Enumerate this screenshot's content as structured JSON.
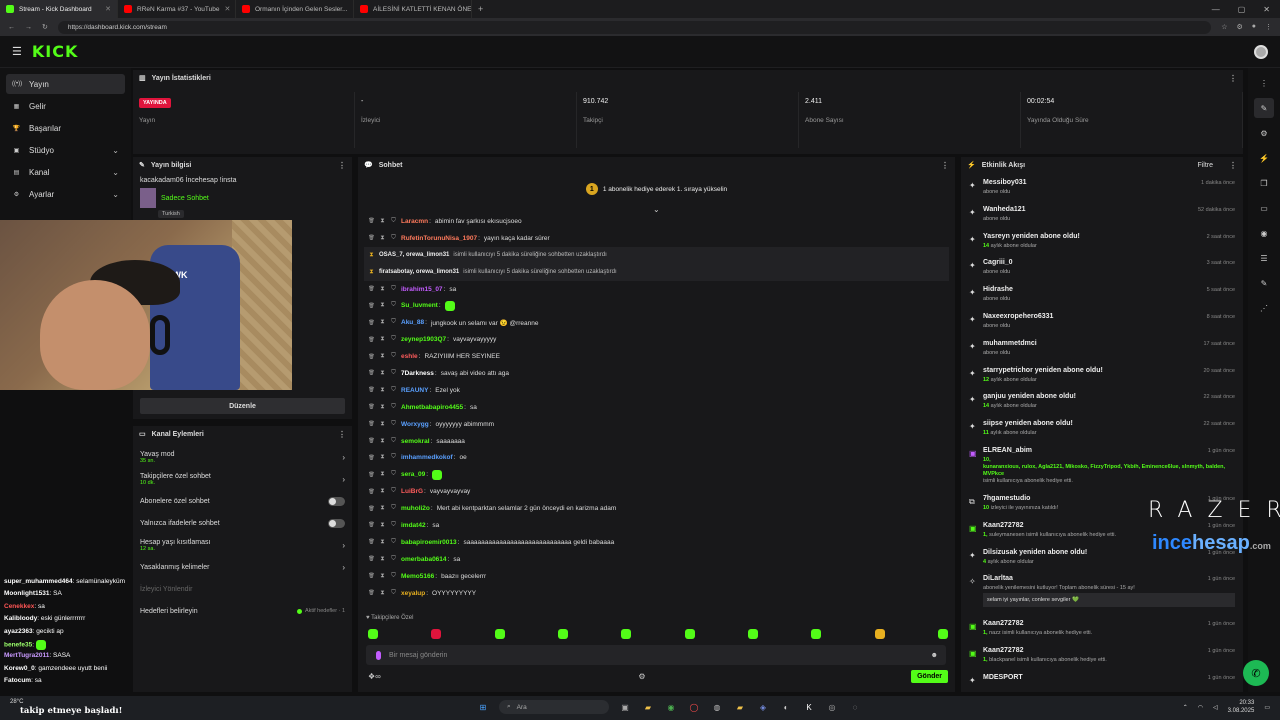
{
  "browser": {
    "tabs": [
      {
        "label": "Stream - Kick Dashboard",
        "color": "#53fc18"
      },
      {
        "label": "RReN Karma #37 - YouTube",
        "color": "#ff0000"
      },
      {
        "label": "Ormanın İçinden Gelen Sesler...",
        "color": "#ff0000"
      },
      {
        "label": "AİLESİNİ KATLETTİ KENAN ÖNEL...",
        "color": "#ff0000"
      }
    ],
    "url": "https://dashboard.kick.com/stream"
  },
  "brand": {
    "logo": "KICK"
  },
  "nav": [
    {
      "label": "Yayın",
      "icon": "broadcast-icon",
      "glyph": "((•))",
      "active": true
    },
    {
      "label": "Gelir",
      "icon": "revenue-icon",
      "glyph": "▦"
    },
    {
      "label": "Başarılar",
      "icon": "trophy-icon",
      "glyph": "🏆"
    },
    {
      "label": "Stüdyo",
      "icon": "studio-icon",
      "glyph": "▣",
      "chevron": true
    },
    {
      "label": "Kanal",
      "icon": "channel-icon",
      "glyph": "▤",
      "chevron": true
    },
    {
      "label": "Ayarlar",
      "icon": "settings-icon",
      "glyph": "⚙",
      "chevron": true
    }
  ],
  "stats": {
    "title": "Yayın İstatistikleri",
    "items": [
      {
        "value": "YAYINDA",
        "label": "Yayın"
      },
      {
        "value": "-",
        "label": "İzleyici"
      },
      {
        "value": "910.742",
        "label": "Takipçi"
      },
      {
        "value": "2.411",
        "label": "Abone Sayısı"
      },
      {
        "value": "00:02:54",
        "label": "Yayında Olduğu Süre"
      }
    ]
  },
  "yayin_info": {
    "title": "Yayın bilgisi",
    "stream_title": "kacakadam06 İncehesap !insta",
    "mode": "Sadece Sohbet",
    "language": "Turkish",
    "edit_label": "Düzenle",
    "cam_label": "HAWK"
  },
  "kanal": {
    "title": "Kanal Eylemleri",
    "items": [
      {
        "label": "Yavaş mod",
        "sub": "35 sn.",
        "control": "arrow"
      },
      {
        "label": "Takipçilere özel sohbet",
        "sub": "10 dk.",
        "control": "arrow"
      },
      {
        "label": "Abonelere özel sohbet",
        "sub": "",
        "control": "toggle"
      },
      {
        "label": "Yalnızca ifadelerle sohbet",
        "sub": "",
        "control": "toggle"
      },
      {
        "label": "Hesap yaşı kısıtlaması",
        "sub": "12 sa.",
        "control": "arrow"
      },
      {
        "label": "Yasaklanmış kelimeler",
        "sub": "",
        "control": "arrow"
      }
    ],
    "muted_label": "İzleyici Yönlendir",
    "goals_label": "Hedefleri belirleyin",
    "goals_status": "Aktif hedefler · 1"
  },
  "overlay_chat": [
    {
      "user": "super_muhammed464",
      "text": "selamünaleyküm",
      "color": "#ffffff"
    },
    {
      "user": "Moonlight1531",
      "text": "SA",
      "color": "#ffffff"
    },
    {
      "user": "Cenekkex",
      "text": "sa",
      "color": "#ff5555"
    },
    {
      "user": "Kalibloody",
      "text": "eski günlerrrrrrr",
      "color": "#ffffff"
    },
    {
      "user": "ayaz2363",
      "text": "gecikti ap",
      "color": "#ffffff"
    },
    {
      "user": "benefe35",
      "text": "",
      "color": "#9bff6b",
      "emote": true
    },
    {
      "user": "MertTugra2011",
      "text": "SASA",
      "color": "#c99aff"
    },
    {
      "user": "Korew0_0",
      "text": "gamzendeee uyutt benii",
      "color": "#ffffff"
    },
    {
      "user": "Fatocum",
      "text": "sa",
      "color": "#ffffff"
    }
  ],
  "chat": {
    "title": "Sohbet",
    "pinned": "1 abonelik hediye ederek 1. sıraya yükselin",
    "pin_num": "1",
    "messages": [
      {
        "user": "Laracmn",
        "text": "abimin fav şarkısı ekısucjsoeo",
        "color": "#ff7a5c"
      },
      {
        "user": "RufetinTorunuNisa_1907",
        "text": "yayın kaça kadar sürer",
        "color": "#ff7a5c"
      },
      {
        "sys": true,
        "user": "OSAS_7, orewa_limon31",
        "text": "isimli kullanıcıyı 5 dakika süreliğine sohbetten uzaklaştırdı"
      },
      {
        "sys": true,
        "user": "firatsabotay, orewa_limon31",
        "text": "isimli kullanıcıyı 5 dakika süreliğine sohbetten uzaklaştırdı"
      },
      {
        "user": "ibrahim15_07",
        "text": "sa",
        "color": "#c35cff"
      },
      {
        "user": "Su_luvment",
        "text": "",
        "color": "#53fc18",
        "emote": true
      },
      {
        "user": "Aku_88",
        "text": "jungkook un selamı var 😉 @rreanne",
        "color": "#5aa0ff"
      },
      {
        "user": "zeynep1903Q7",
        "text": "vayvayvayyyyy",
        "color": "#53fc18"
      },
      {
        "user": "eshle",
        "text": "RAZIYIIIM HER SEYINEE",
        "color": "#ff5c5c"
      },
      {
        "user": "7Darkness",
        "text": "savaş abi video attı aga",
        "color": "#ffffff"
      },
      {
        "user": "REAUNY",
        "text": "Ezel yok",
        "color": "#5aa0ff"
      },
      {
        "user": "Ahmetbabapiro4455",
        "text": "sa",
        "color": "#53fc18"
      },
      {
        "user": "Worxygg",
        "text": "oyyyyyyy abimmmm",
        "color": "#5aa0ff"
      },
      {
        "user": "semokral",
        "text": "saaaaaaa",
        "color": "#53fc18"
      },
      {
        "user": "imhammedkokof",
        "text": "oe",
        "color": "#5aa0ff"
      },
      {
        "user": "sera_09",
        "text": "",
        "color": "#53fc18",
        "emote": true
      },
      {
        "user": "LuiBrG",
        "text": "vayvayvayvay",
        "color": "#ff5c5c"
      },
      {
        "user": "muholi2o",
        "text": "Mert abi kentparktan selamlar 2 gün önceydi en karizma adam",
        "color": "#53fc18"
      },
      {
        "user": "imdat42",
        "text": "sa",
        "color": "#53fc18"
      },
      {
        "user": "babapiroemir0013",
        "text": "saaaaaaaaaaaaaaaaaaaaaaaaaaaaa geldi babaaaa",
        "color": "#53fc18"
      },
      {
        "user": "omerbaba0614",
        "text": "sa",
        "color": "#53fc18"
      },
      {
        "user": "Memo5166",
        "text": "baazıı gecelerrr",
        "color": "#53fc18"
      },
      {
        "user": "xeyalup",
        "text": "OYYYYYYYYY",
        "color": "#e8b020"
      }
    ],
    "followers_only": "Takipçilere Özel",
    "input_placeholder": "Bir mesaj gönderin",
    "send_label": "Gönder"
  },
  "events": {
    "title": "Etkinlik Akışı",
    "filter_label": "Filtre",
    "items": [
      {
        "title": "Messiboy031",
        "sub": "abone oldu",
        "time": "1 dakika önce",
        "icon": "star-icon",
        "glyph": "✦"
      },
      {
        "title": "Wanheda121",
        "sub": "abone oldu",
        "time": "52 dakika önce",
        "icon": "star-icon",
        "glyph": "✦"
      },
      {
        "title": "Yasreyn yeniden abone oldu!",
        "hl": "14",
        "sub": "aylık abone oldular",
        "time": "2 saat önce",
        "icon": "star-icon",
        "glyph": "✦"
      },
      {
        "title": "Cagriii_0",
        "sub": "abone oldu",
        "time": "3 saat önce",
        "icon": "star-icon",
        "glyph": "✦"
      },
      {
        "title": "Hidrashe",
        "sub": "abone oldu",
        "time": "5 saat önce",
        "icon": "star-icon",
        "glyph": "✦"
      },
      {
        "title": "Naxeexropehero6331",
        "sub": "abone oldu",
        "time": "8 saat önce",
        "icon": "star-icon",
        "glyph": "✦"
      },
      {
        "title": "muhammetdmci",
        "sub": "abone oldu",
        "time": "17 saat önce",
        "icon": "star-icon",
        "glyph": "✦"
      },
      {
        "title": "starrypetrichor yeniden abone oldu!",
        "hl": "12",
        "sub": "aylık abone oldular",
        "time": "20 saat önce",
        "icon": "star-icon",
        "glyph": "✦"
      },
      {
        "title": "ganjuu yeniden abone oldu!",
        "hl": "14",
        "sub": "aylık abone oldular",
        "time": "22 saat önce",
        "icon": "star-icon",
        "glyph": "✦"
      },
      {
        "title": "siipse yeniden abone oldu!",
        "hl": "11",
        "sub": "aylık abone oldular",
        "time": "22 saat önce",
        "icon": "star-icon",
        "glyph": "✦"
      },
      {
        "title": "ELREAN_abim",
        "hl": "10,",
        "sub": "kunaranxious, rulox, Agla2121, Mikosko, FizzyTripod, Ykbih, Eminence6lue, slnmyth, balden, MVPkce",
        "sub2": "isimli kullanıcıya abonelik hediye etti.",
        "time": "1 gün önce",
        "icon": "gift-icon",
        "glyph": "▣",
        "tall": true
      },
      {
        "title": "7hgamestudio",
        "hl": "10",
        "sub": "izleyici ile yayınınıza katıldı!",
        "time": "1 gün önce",
        "icon": "raid-icon",
        "glyph": "⧉"
      },
      {
        "title": "Kaan272782",
        "hl": "1,",
        "sub": "suleymanesen isimli kullanıcıya abonelik hediye etti.",
        "time": "1 gün önce",
        "icon": "gift-icon",
        "glyph": "▣"
      },
      {
        "title": "Dilsizusak yeniden abone oldu!",
        "hl": "4",
        "sub": "aylık abone oldular",
        "time": "1 gün önce",
        "icon": "star-icon",
        "glyph": "✦"
      },
      {
        "title": "DiLarltaa",
        "sub": "abonelik yenilemesini kutluyor! Toplam abonelik süresi - 15 ay!",
        "box": "selam iyi yayınlar, conlere sevgiler 💚",
        "time": "1 gün önce",
        "icon": "party-icon",
        "glyph": "✧",
        "tall": true
      },
      {
        "title": "Kaan272782",
        "hl": "1,",
        "sub": "nazz isimli kullanıcıya abonelik hediye etti.",
        "time": "1 gün önce",
        "icon": "gift-icon",
        "glyph": "▣"
      },
      {
        "title": "Kaan272782",
        "hl": "1,",
        "sub": "blackpanel isimli kullanıcıya abonelik hediye etti.",
        "time": "1 gün önce",
        "icon": "gift-icon",
        "glyph": "▣"
      },
      {
        "title": "MDESPORT",
        "sub": "",
        "time": "1 gün önce",
        "icon": "star-icon",
        "glyph": "✦"
      }
    ]
  },
  "overlay_brands": {
    "razer": "RAZER",
    "incehesap_a": "ince",
    "incehesap_b": "hesap",
    "incehesap_c": ".com"
  },
  "taskbar": {
    "weather": "28°C",
    "follow_text": "takip etmeye başladı!",
    "search": "Ara",
    "time": "20:33",
    "date": "3.08.2025"
  }
}
